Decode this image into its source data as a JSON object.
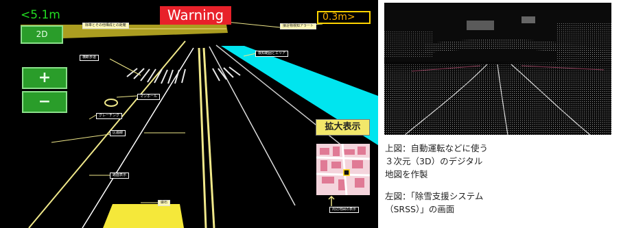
{
  "srss_screen": {
    "distance_left": "<5.1m",
    "view_mode_button": "2D",
    "zoom_in_label": "+",
    "zoom_out_label": "−",
    "warning_label": "Warning",
    "distance_right": "0.3m>",
    "enlarge_button": "拡大表示",
    "colors": {
      "lane": "#f0e88a",
      "warning_red": "#e8212a",
      "range_cyan": "#00e5ef",
      "button_green": "#2a9d2a"
    },
    "annotations": {
      "vehicle_distance": "除車とその他構成との距離",
      "approach_alert": "接近物検知アラート",
      "crosswalk": "横断歩道",
      "area": "検知範囲とエリア",
      "manhole": "マンホール",
      "grating": "グレーチング",
      "center_line": "区画線",
      "road_marking": "路面表示",
      "curb": "縁石",
      "map_legend": "周辺地図の表示"
    }
  },
  "captions": {
    "top_line1": "上図：自動運転などに使う",
    "top_line2": "３次元（3D）のデジタル",
    "top_line3": "地図を作製",
    "left_line1": "左図：「除雪支援システム",
    "left_line2": "（SRSS）」の画面"
  }
}
